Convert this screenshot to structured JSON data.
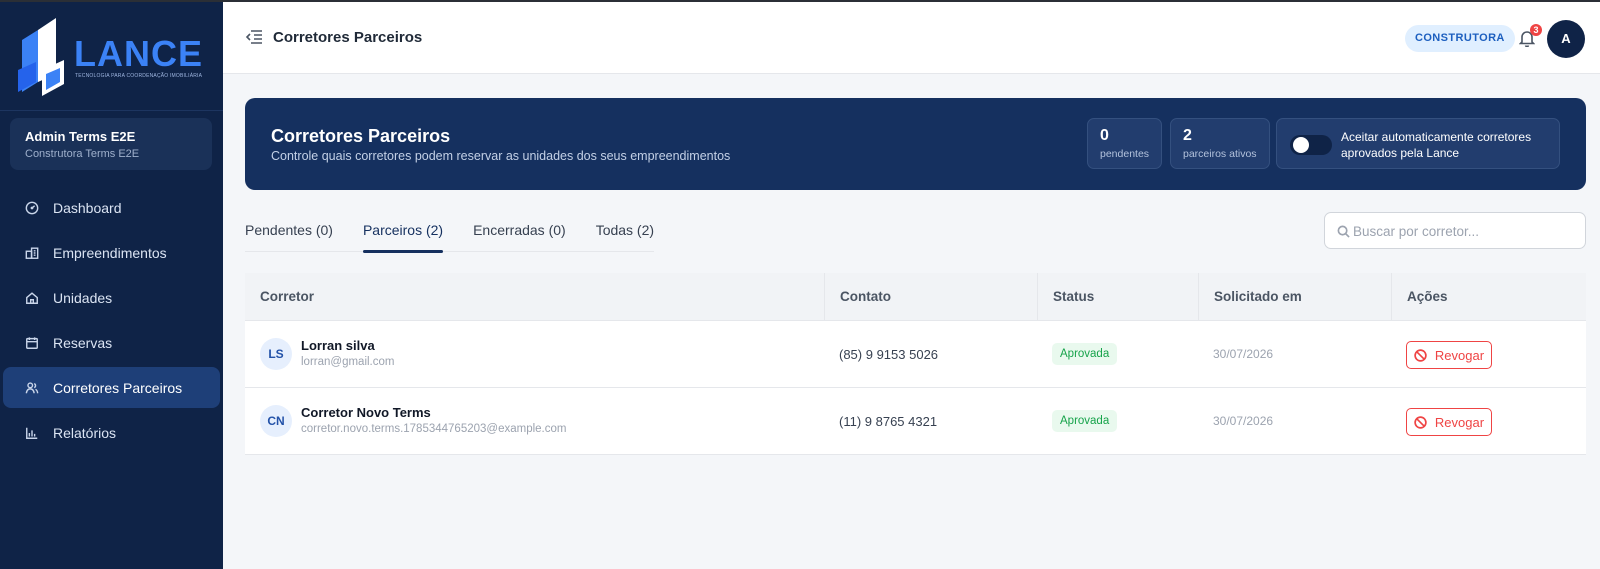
{
  "app": {
    "logo_text": "LANCE",
    "logo_tagline": "TECNOLOGIA PARA COORDENAÇÃO IMOBILIÁRIA"
  },
  "sidebar": {
    "user_name": "Admin Terms E2E",
    "user_company": "Construtora Terms E2E",
    "items": [
      {
        "label": "Dashboard",
        "icon": "dashboard-icon",
        "active": false
      },
      {
        "label": "Empreendimentos",
        "icon": "buildings-icon",
        "active": false
      },
      {
        "label": "Unidades",
        "icon": "home-icon",
        "active": false
      },
      {
        "label": "Reservas",
        "icon": "calendar-icon",
        "active": false
      },
      {
        "label": "Corretores Parceiros",
        "icon": "users-icon",
        "active": true
      },
      {
        "label": "Relatórios",
        "icon": "bar-chart-icon",
        "active": false
      }
    ]
  },
  "header": {
    "title": "Corretores Parceiros",
    "role_badge": "CONSTRUTORA",
    "notification_count": "3",
    "avatar_initial": "A"
  },
  "banner": {
    "title": "Corretores Parceiros",
    "subtitle": "Controle quais corretores podem reservar as unidades dos seus empreendimentos",
    "stats": [
      {
        "value": "0",
        "label": "pendentes"
      },
      {
        "value": "2",
        "label": "parceiros ativos"
      }
    ],
    "auto_accept_label": "Aceitar automaticamente corretores aprovados pela Lance",
    "auto_accept_on": false
  },
  "tabs": [
    {
      "label": "Pendentes (0)",
      "active": false
    },
    {
      "label": "Parceiros (2)",
      "active": true
    },
    {
      "label": "Encerradas (0)",
      "active": false
    },
    {
      "label": "Todas (2)",
      "active": false
    }
  ],
  "search": {
    "placeholder": "Buscar por corretor..."
  },
  "table": {
    "headers": [
      "Corretor",
      "Contato",
      "Status",
      "Solicitado em",
      "Ações"
    ],
    "rows": [
      {
        "initials": "LS",
        "name": "Lorran silva",
        "email": "lorran@gmail.com",
        "contact": "(85) 9 9153 5026",
        "status": "Aprovada",
        "requested_at": "30/07/2026",
        "action": "Revogar"
      },
      {
        "initials": "CN",
        "name": "Corretor Novo Terms",
        "email": "corretor.novo.terms.1785344765203@example.com",
        "contact": "(11) 9 8765 4321",
        "status": "Aprovada",
        "requested_at": "30/07/2026",
        "action": "Revogar"
      }
    ]
  },
  "colors": {
    "sidebar_bg": "#0f2347",
    "banner_bg": "#15305f",
    "accent_blue": "#3b82f6",
    "status_green": "#16a34a",
    "danger_red": "#ef4444"
  }
}
